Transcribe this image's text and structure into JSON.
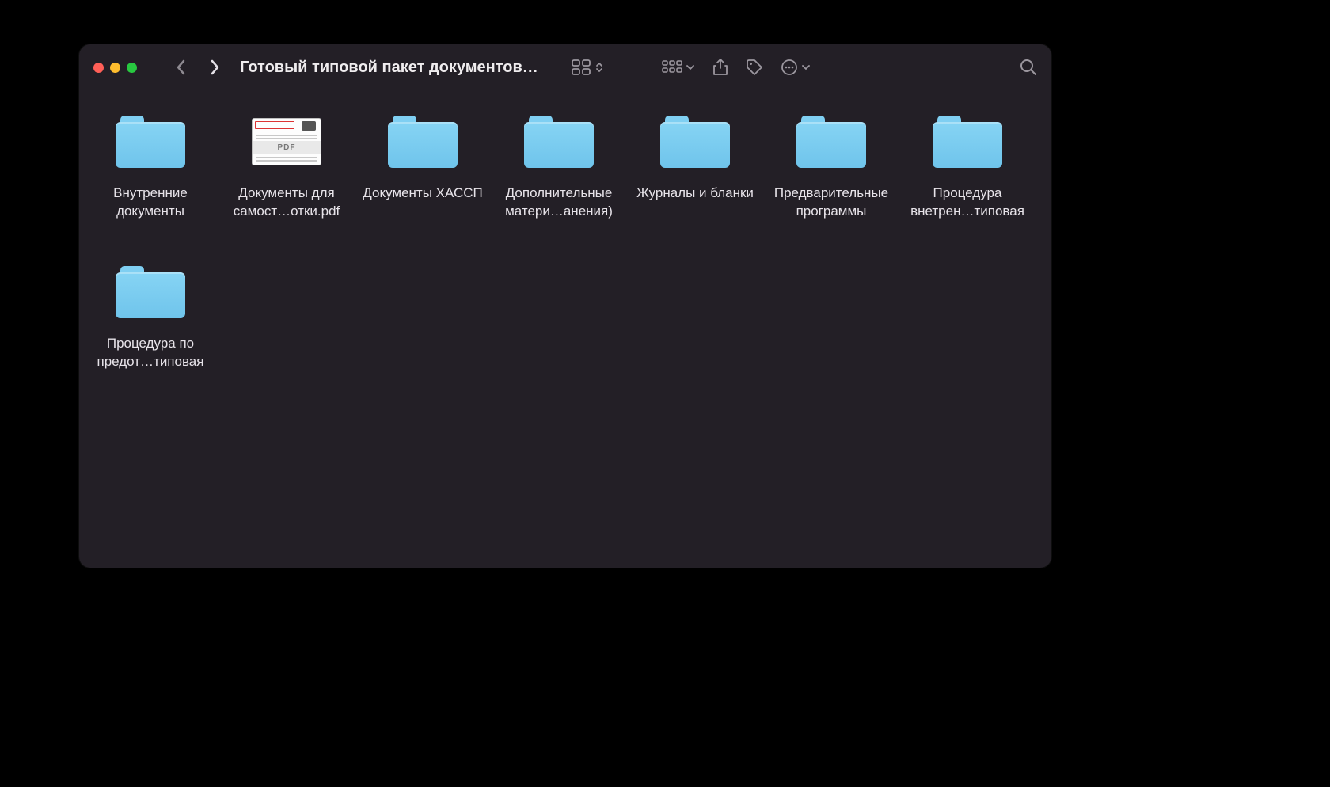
{
  "window": {
    "title": "Готовый типовой пакет документов…"
  },
  "items": [
    {
      "type": "folder",
      "name": "Внутренние документы"
    },
    {
      "type": "pdf",
      "name": "Документы для самост…отки.pdf",
      "badge": "PDF"
    },
    {
      "type": "folder",
      "name": "Документы ХАССП"
    },
    {
      "type": "folder",
      "name": "Дополнительные матери…анения)"
    },
    {
      "type": "folder",
      "name": "Журналы и бланки"
    },
    {
      "type": "folder",
      "name": "Предварительные программы"
    },
    {
      "type": "folder",
      "name": "Процедура внетрен…типовая"
    },
    {
      "type": "folder",
      "name": "Процедура по предот…типовая"
    }
  ],
  "colors": {
    "folder": "#7fcff2",
    "window_bg": "#231f26"
  }
}
